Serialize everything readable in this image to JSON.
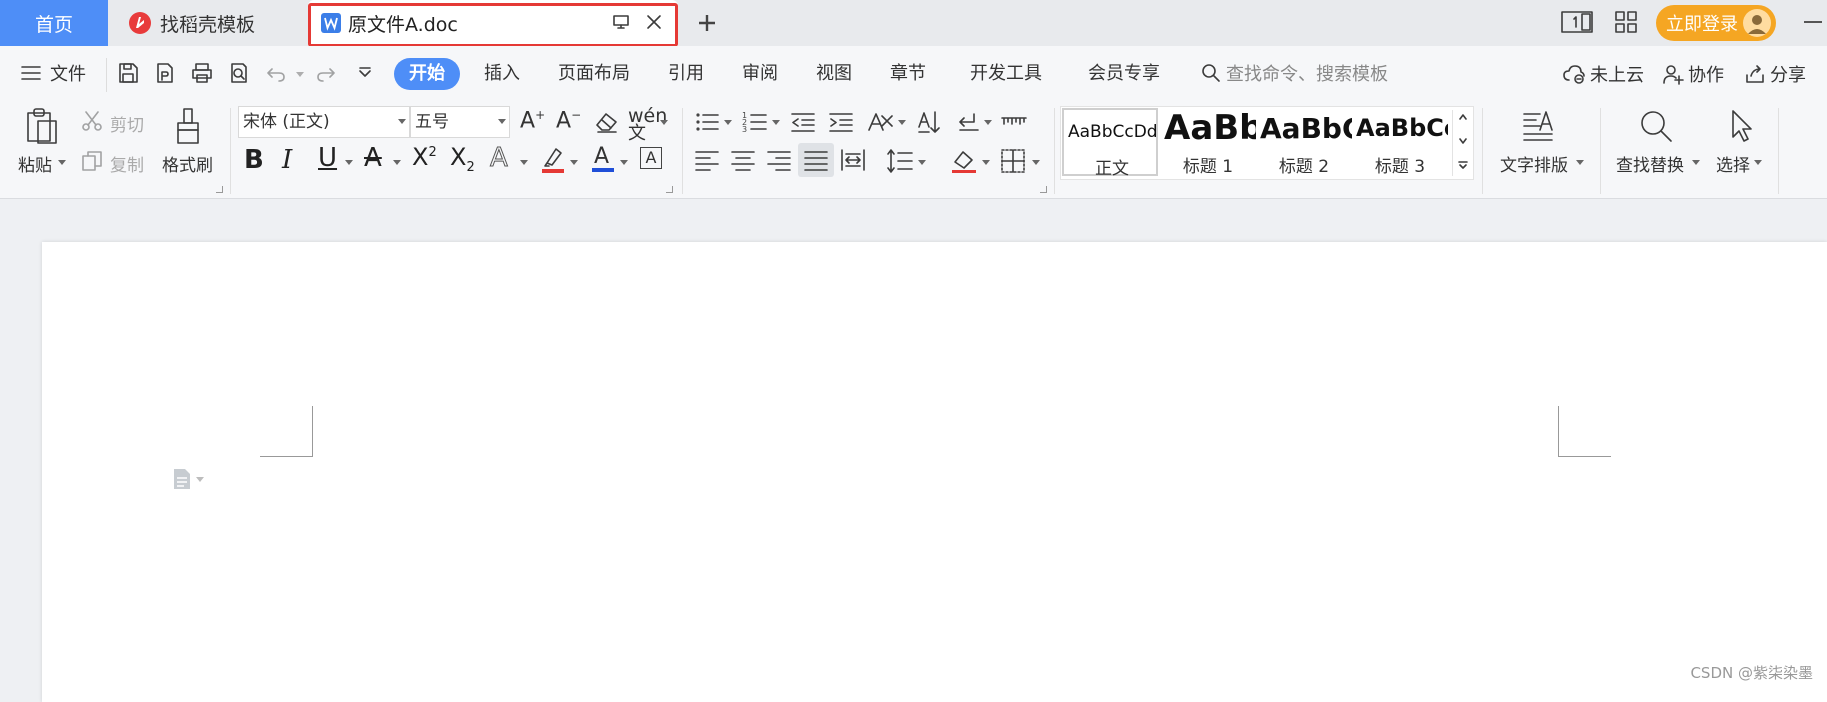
{
  "tabs": {
    "home": "首页",
    "templates": "找稻壳模板",
    "document": "原文件A.doc"
  },
  "titlebar": {
    "login": "立即登录"
  },
  "menu": {
    "file": "文件",
    "items": [
      "开始",
      "插入",
      "页面布局",
      "引用",
      "审阅",
      "视图",
      "章节",
      "开发工具",
      "会员专享"
    ],
    "search_placeholder": "查找命令、搜索模板",
    "cloud": "未上云",
    "collaborate": "协作",
    "share": "分享"
  },
  "ribbon": {
    "paste": "粘贴",
    "cut": "剪切",
    "copy": "复制",
    "format_painter": "格式刷",
    "font_name": "宋体 (正文)",
    "font_size": "五号",
    "styles": [
      {
        "sample": "AaBbCcDd",
        "name": "正文"
      },
      {
        "sample": "AaBb",
        "name": "标题 1"
      },
      {
        "sample": "AaBbC",
        "name": "标题 2"
      },
      {
        "sample": "AaBbCc",
        "name": "标题 3"
      }
    ],
    "text_layout": "文字排版",
    "find_replace": "查找替换",
    "select": "选择"
  },
  "watermark": "CSDN @紫柒染墨",
  "colors": {
    "accent": "#4e8ef7",
    "login": "#f5a623",
    "highlight_border": "#e53935",
    "highlight_color": "#e53935",
    "font_color": "#1f4fd8"
  }
}
